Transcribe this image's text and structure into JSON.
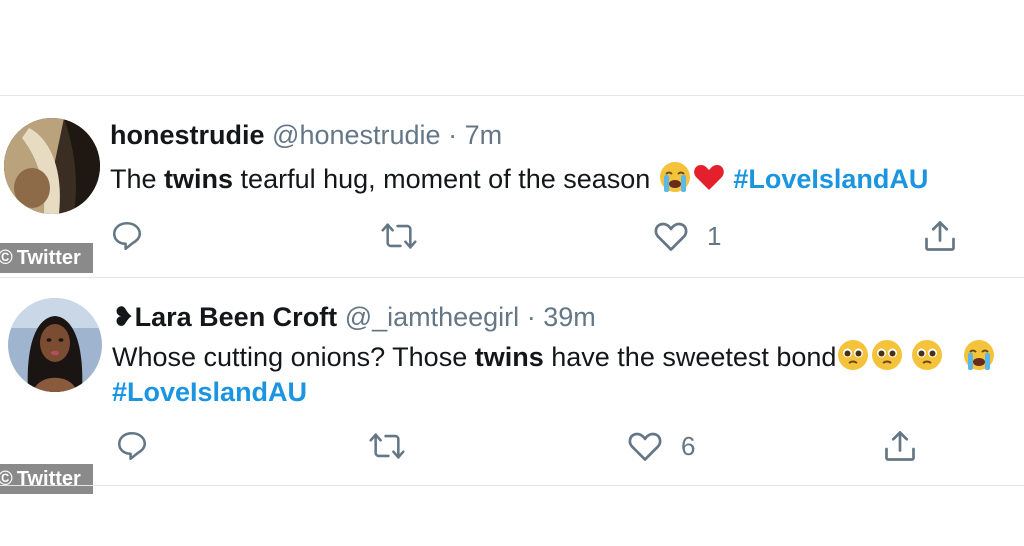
{
  "tweets": [
    {
      "name": "honestrudie",
      "handle": "@honestrudie",
      "separator": "·",
      "time": "7m",
      "text_parts": {
        "pre": "The ",
        "bold": "twins",
        "post": " tearful hug, moment of the season",
        "hashtag": "#LoveIslandAU"
      },
      "emojis": [
        "loudly-crying-face",
        "red-heart"
      ],
      "like_count": "1",
      "watermark": "Twitter",
      "watermark_symbol": "©"
    },
    {
      "name_prefix": "❥",
      "name": "Lara Been Croft",
      "handle": "@_iamtheegirl",
      "separator": "·",
      "time": "39m",
      "text_parts": {
        "pre": "Whose cutting onions? Those ",
        "bold": "twins",
        "post": " have the sweetest bond",
        "hashtag": "#LoveIslandAU"
      },
      "emojis": [
        "pleading-face",
        "pleading-face",
        "pleading-face",
        "loudly-crying-face"
      ],
      "like_count": "6",
      "watermark": "Twitter",
      "watermark_symbol": "©"
    }
  ],
  "colors": {
    "hashtag": "#1b95e0",
    "secondary_text": "#657786",
    "divider": "#e3e6e8",
    "watermark_bg": "#8a8a8a"
  },
  "icons": [
    "reply-icon",
    "retweet-icon",
    "like-icon",
    "share-icon"
  ]
}
